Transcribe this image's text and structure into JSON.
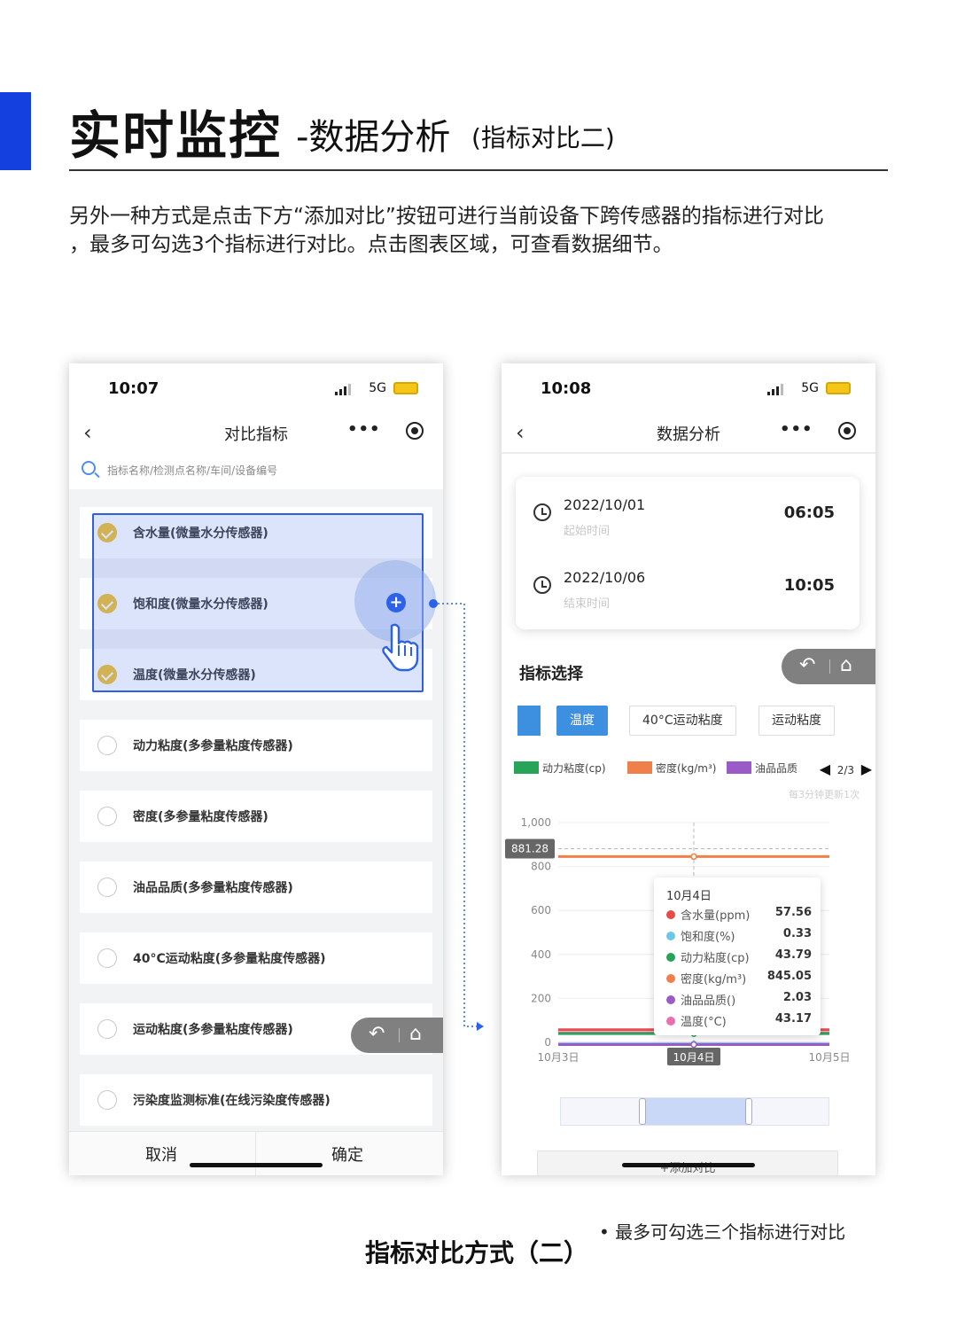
{
  "slide": {
    "title_main": "实时监控",
    "title_sub": "-数据分析",
    "title_note": "(指标对比二)",
    "description_line1": "另外一种方式是点击下方“添加对比”按钮可进行当前设备下跨传感器的指标进行对比",
    "description_line2": "，最多可勾选3个指标进行对比。点击图表区域，可查看数据细节。",
    "caption": "指标对比方式（二）",
    "bullet": "• 最多可勾选三个指标进行对比",
    "accent_color": "#1440e0"
  },
  "left_phone": {
    "status": {
      "time": "10:07",
      "network": "5G"
    },
    "nav": {
      "back": "‹",
      "title": "对比指标",
      "more": "•••",
      "icons": [
        "more-icon",
        "target-icon"
      ]
    },
    "search_placeholder": "指标名称/检测点名称/车间/设备编号",
    "items": [
      {
        "label": "含水量(微量水分传感器)",
        "checked": true
      },
      {
        "label": "饱和度(微量水分传感器)",
        "checked": true
      },
      {
        "label": "温度(微量水分传感器)",
        "checked": true
      },
      {
        "label": "动力粘度(多参量粘度传感器)",
        "checked": false
      },
      {
        "label": "密度(多参量粘度传感器)",
        "checked": false
      },
      {
        "label": "油品品质(多参量粘度传感器)",
        "checked": false
      },
      {
        "label": "40°C运动粘度(多参量粘度传感器)",
        "checked": false
      },
      {
        "label": "运动粘度(多参量粘度传感器)",
        "checked": false
      },
      {
        "label": "污染度监测标准(在线污染度传感器)",
        "checked": false
      }
    ],
    "cancel_label": "取消",
    "confirm_label": "确定",
    "plus_label": "+",
    "float_icons": [
      "back-arrow-icon",
      "home-icon"
    ]
  },
  "right_phone": {
    "status": {
      "time": "10:08",
      "network": "5G"
    },
    "nav": {
      "back": "‹",
      "title": "数据分析",
      "more": "•••"
    },
    "start": {
      "date": "2022/10/01",
      "label": "起始时间",
      "time": "06:05"
    },
    "end": {
      "date": "2022/10/06",
      "label": "结束时间",
      "time": "10:05"
    },
    "section_title": "指标选择",
    "chips": [
      {
        "label": "温度",
        "active": true
      },
      {
        "label": "40°C运动粘度",
        "active": false
      },
      {
        "label": "运动粘度",
        "active": false
      }
    ],
    "legend": [
      {
        "label": "动力粘度(cp)",
        "color": "#27a35a"
      },
      {
        "label": "密度(kg/m³)",
        "color": "#f0804a"
      },
      {
        "label": "油品品质",
        "color": "#9a5bc8"
      }
    ],
    "legend_page": "2/3",
    "update_note": "每3分钟更新1次",
    "add_compare_label": "+添加对比",
    "tooltip": {
      "title": "10月4日",
      "rows": [
        {
          "label": "含水量(ppm)",
          "value": "57.56",
          "color": "#e64a4a"
        },
        {
          "label": "饱和度(%)",
          "value": "0.33",
          "color": "#6ec6e6"
        },
        {
          "label": "动力粘度(cp)",
          "value": "43.79",
          "color": "#27a35a"
        },
        {
          "label": "密度(kg/m³)",
          "value": "845.05",
          "color": "#f0804a"
        },
        {
          "label": "油品品质()",
          "value": "2.03",
          "color": "#9a5bc8"
        },
        {
          "label": "温度(°C)",
          "value": "43.17",
          "color": "#e86fb0"
        }
      ]
    }
  },
  "chart_data": {
    "type": "line",
    "title": "",
    "xlabel": "",
    "ylabel": "",
    "x": [
      "10月3日",
      "10月4日",
      "10月5日"
    ],
    "ylim": [
      0,
      1000
    ],
    "yticks": [
      0,
      200,
      400,
      600,
      800,
      1000
    ],
    "y_ticklabels": [
      "0",
      "200",
      "400",
      "600",
      "800",
      "1,000"
    ],
    "highlight_label": "881.28",
    "highlight_value": 881.28,
    "selected_x": "10月4日",
    "grid": true,
    "series": [
      {
        "name": "密度(kg/m³)",
        "color": "#f0804a",
        "values": [
          845.05,
          845.05,
          845.05
        ]
      },
      {
        "name": "含水量(ppm)",
        "color": "#e64a4a",
        "values": [
          57.56,
          57.56,
          57.56
        ]
      },
      {
        "name": "温度(°C)",
        "color": "#e86fb0",
        "values": [
          43.17,
          43.17,
          43.17
        ]
      },
      {
        "name": "动力粘度(cp)",
        "color": "#27a35a",
        "values": [
          43.79,
          43.79,
          43.79
        ]
      },
      {
        "name": "饱和度(%)",
        "color": "#6ec6e6",
        "values": [
          0.33,
          0.33,
          0.33
        ]
      },
      {
        "name": "油品品质()",
        "color": "#9a5bc8",
        "values": [
          2.03,
          2.03,
          2.03
        ]
      }
    ]
  }
}
